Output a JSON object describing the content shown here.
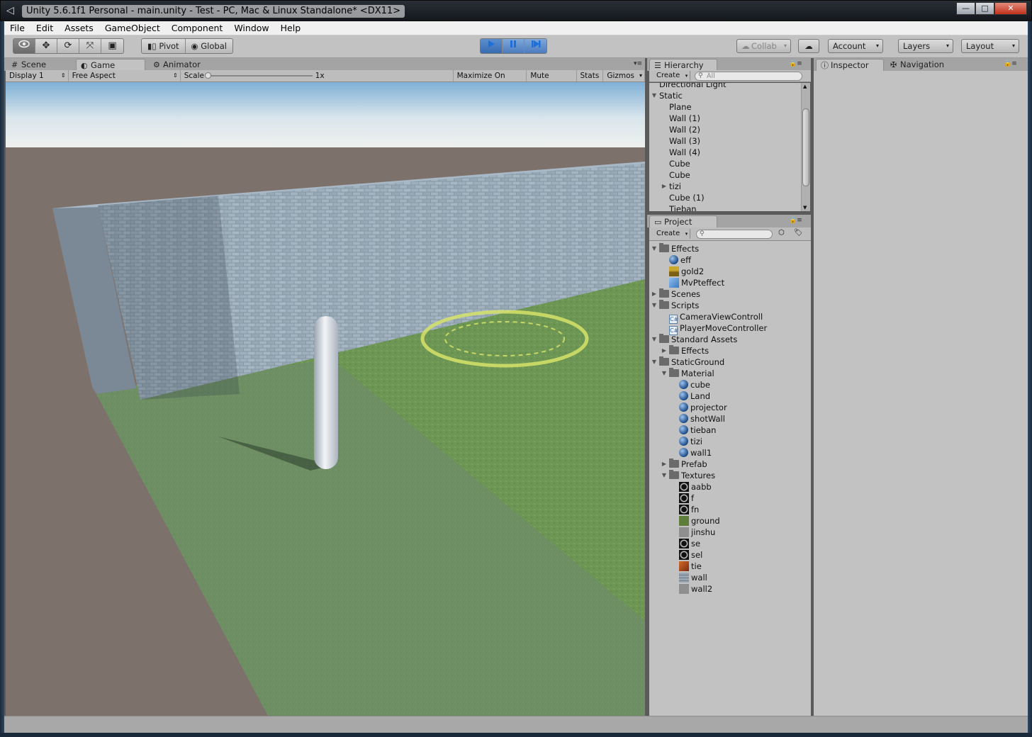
{
  "window": {
    "title": "Unity 5.6.1f1 Personal - main.unity - Test - PC, Mac & Linux Standalone* <DX11>",
    "buttons": {
      "minimize": "—",
      "maximize": "□",
      "close": "✕"
    }
  },
  "menu": [
    "File",
    "Edit",
    "Assets",
    "GameObject",
    "Component",
    "Window",
    "Help"
  ],
  "toolbar": {
    "transform_tools": [
      "view-tool",
      "move-tool",
      "rotate-tool",
      "scale-tool",
      "rect-tool"
    ],
    "pivot_label": "Pivot",
    "global_label": "Global",
    "playback": {
      "playing": true
    },
    "collab_label": "Collab",
    "account_label": "Account",
    "layers_label": "Layers",
    "layout_label": "Layout"
  },
  "left_tabs": [
    {
      "label": "Scene",
      "icon": "#"
    },
    {
      "label": "Game",
      "icon": "◐",
      "active": true
    },
    {
      "label": "Animator",
      "icon": "⚙"
    }
  ],
  "game_toolbar": {
    "display": "Display 1",
    "aspect": "Free Aspect",
    "scale_label": "Scale",
    "scale_value": "1x",
    "maximize": "Maximize On Play",
    "mute": "Mute Audio",
    "stats": "Stats",
    "gizmos": "Gizmos"
  },
  "hierarchy": {
    "tab_label": "Hierarchy",
    "create_label": "Create",
    "search_placeholder": "All",
    "items": [
      {
        "label": "Directional Light",
        "depth": 0,
        "fold": ""
      },
      {
        "label": "Static",
        "depth": 0,
        "fold": "open"
      },
      {
        "label": "Plane",
        "depth": 1,
        "fold": ""
      },
      {
        "label": "Wall (1)",
        "depth": 1,
        "fold": ""
      },
      {
        "label": "Wall (2)",
        "depth": 1,
        "fold": ""
      },
      {
        "label": "Wall (3)",
        "depth": 1,
        "fold": ""
      },
      {
        "label": "Wall (4)",
        "depth": 1,
        "fold": ""
      },
      {
        "label": "Cube",
        "depth": 1,
        "fold": ""
      },
      {
        "label": "Cube",
        "depth": 1,
        "fold": ""
      },
      {
        "label": "tizi",
        "depth": 1,
        "fold": "closed"
      },
      {
        "label": "Cube (1)",
        "depth": 1,
        "fold": ""
      },
      {
        "label": "Tieban",
        "depth": 1,
        "fold": ""
      }
    ]
  },
  "project": {
    "tab_label": "Project",
    "create_label": "Create",
    "items": [
      {
        "label": "Effects",
        "depth": 0,
        "fold": "open",
        "icon": "folder"
      },
      {
        "label": "eff",
        "depth": 1,
        "fold": "",
        "icon": "sphere"
      },
      {
        "label": "gold2",
        "depth": 1,
        "fold": "",
        "icon": "tex-gold"
      },
      {
        "label": "MvPteffect",
        "depth": 1,
        "fold": "",
        "icon": "prefab"
      },
      {
        "label": "Scenes",
        "depth": 0,
        "fold": "closed",
        "icon": "folder"
      },
      {
        "label": "Scripts",
        "depth": 0,
        "fold": "open",
        "icon": "folder"
      },
      {
        "label": "CameraViewControll",
        "depth": 1,
        "fold": "",
        "icon": "script"
      },
      {
        "label": "PlayerMoveController",
        "depth": 1,
        "fold": "",
        "icon": "script"
      },
      {
        "label": "Standard Assets",
        "depth": 0,
        "fold": "open",
        "icon": "folder"
      },
      {
        "label": "Effects",
        "depth": 1,
        "fold": "closed",
        "icon": "folder"
      },
      {
        "label": "StaticGround",
        "depth": 0,
        "fold": "open",
        "icon": "folder"
      },
      {
        "label": "Material",
        "depth": 1,
        "fold": "open",
        "icon": "folder"
      },
      {
        "label": "cube",
        "depth": 2,
        "fold": "",
        "icon": "sphere"
      },
      {
        "label": "Land",
        "depth": 2,
        "fold": "",
        "icon": "sphere"
      },
      {
        "label": "projector",
        "depth": 2,
        "fold": "",
        "icon": "sphere"
      },
      {
        "label": "shotWall",
        "depth": 2,
        "fold": "",
        "icon": "sphere"
      },
      {
        "label": "tieban",
        "depth": 2,
        "fold": "",
        "icon": "sphere"
      },
      {
        "label": "tizi",
        "depth": 2,
        "fold": "",
        "icon": "sphere"
      },
      {
        "label": "wall1",
        "depth": 2,
        "fold": "",
        "icon": "sphere"
      },
      {
        "label": "Prefab",
        "depth": 1,
        "fold": "closed",
        "icon": "folder"
      },
      {
        "label": "Textures",
        "depth": 1,
        "fold": "open",
        "icon": "folder"
      },
      {
        "label": "aabb",
        "depth": 2,
        "fold": "",
        "icon": "tex-ring"
      },
      {
        "label": "f",
        "depth": 2,
        "fold": "",
        "icon": "tex-ring"
      },
      {
        "label": "fn",
        "depth": 2,
        "fold": "",
        "icon": "tex-ring"
      },
      {
        "label": "ground",
        "depth": 2,
        "fold": "",
        "icon": "tex-grass"
      },
      {
        "label": "jinshu",
        "depth": 2,
        "fold": "",
        "icon": "tex-metal"
      },
      {
        "label": "se",
        "depth": 2,
        "fold": "",
        "icon": "tex-ring"
      },
      {
        "label": "sel",
        "depth": 2,
        "fold": "",
        "icon": "tex-ring"
      },
      {
        "label": "tie",
        "depth": 2,
        "fold": "",
        "icon": "tex-rust"
      },
      {
        "label": "wall",
        "depth": 2,
        "fold": "",
        "icon": "tex-wall"
      },
      {
        "label": "wall2",
        "depth": 2,
        "fold": "",
        "icon": "tex-metal"
      }
    ]
  },
  "inspector": {
    "tab_label": "Inspector",
    "nav_label": "Navigation"
  },
  "colors": {
    "play_blue": "#1e6fd9",
    "panel_bg": "#c2c2c2",
    "tab_strip": "#a4a4a4"
  }
}
